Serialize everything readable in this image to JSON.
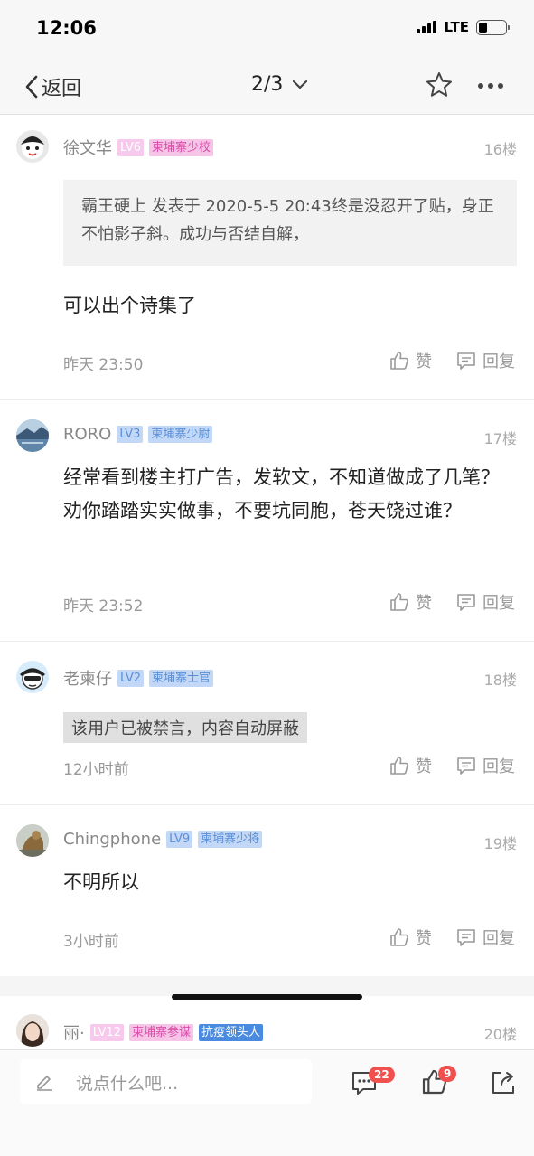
{
  "status_bar": {
    "time": "12:06",
    "network": "LTE"
  },
  "nav": {
    "back_label": "返回",
    "pager": "2/3"
  },
  "posts": [
    {
      "username": "徐文华",
      "level": "LV6",
      "tag": "柬埔寨少校",
      "floor": "16楼",
      "quote": "霸王硬上 发表于 2020-5-5 20:43终是没忍开了贴，身正不怕影子斜。成功与否结自解，",
      "content": "可以出个诗集了",
      "time": "昨天 23:50",
      "like_label": "赞",
      "reply_label": "回复"
    },
    {
      "username": "RORO",
      "level": "LV3",
      "tag": "柬埔寨少尉",
      "floor": "17楼",
      "content": "经常看到楼主打广告，发软文，不知道做成了几笔？劝你踏踏实实做事，不要坑同胞，苍天饶过谁？",
      "time": "昨天 23:52",
      "like_label": "赞",
      "reply_label": "回复"
    },
    {
      "username": "老柬仔",
      "level": "LV2",
      "tag": "柬埔寨士官",
      "floor": "18楼",
      "banned": "该用户已被禁言，内容自动屏蔽",
      "time": "12小时前",
      "like_label": "赞",
      "reply_label": "回复"
    },
    {
      "username": "Chingphone",
      "level": "LV9",
      "tag": "柬埔寨少将",
      "floor": "19楼",
      "content": "不明所以",
      "time": "3小时前",
      "like_label": "赞",
      "reply_label": "回复"
    },
    {
      "username": "丽·",
      "level": "LV12",
      "tag": "柬埔寨参谋",
      "tag2": "抗疫领头人",
      "floor": "20楼"
    }
  ],
  "bottom_bar": {
    "placeholder": "说点什么吧...",
    "comment_count": "22",
    "like_count": "9"
  },
  "colors": {
    "badge_red": "#f0514f",
    "tag_blue": "#4a8be0",
    "tag_pink": "#f6c4e6"
  }
}
